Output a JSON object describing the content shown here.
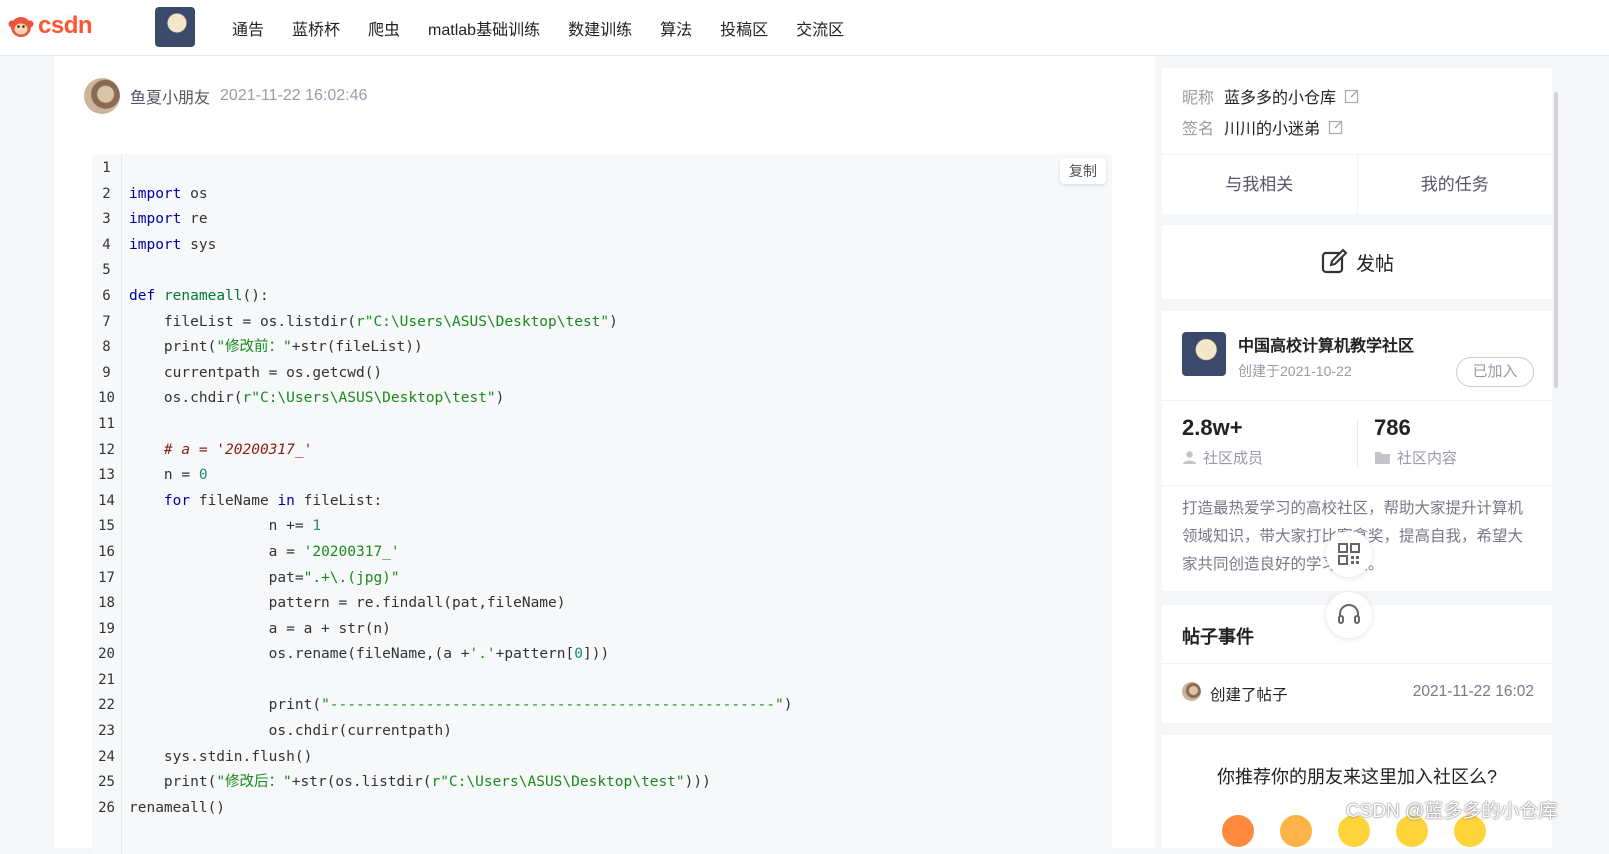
{
  "brand": {
    "logo_text": "csdn"
  },
  "nav": {
    "items": [
      "通告",
      "蓝桥杯",
      "爬虫",
      "matlab基础训练",
      "数建训练",
      "算法",
      "投稿区",
      "交流区"
    ]
  },
  "post": {
    "author": "鱼夏小朋友",
    "time": "2021-11-22 16:02:46",
    "copy_label": "复制"
  },
  "code": {
    "line_numbers": [
      "1",
      "2",
      "3",
      "4",
      "5",
      "6",
      "7",
      "8",
      "9",
      "10",
      "11",
      "12",
      "13",
      "14",
      "15",
      "16",
      "17",
      "18",
      "19",
      "20",
      "21",
      "22",
      "23",
      "24",
      "25",
      "26"
    ],
    "lines": [
      "",
      "import os",
      "import re",
      "import sys",
      "",
      "def renameall():",
      "    fileList = os.listdir(r\"C:\\Users\\ASUS\\Desktop\\test\")",
      "    print(\"修改前：\"+str(fileList))",
      "    currentpath = os.getcwd()",
      "    os.chdir(r\"C:\\Users\\ASUS\\Desktop\\test\")",
      "",
      "    # a = '20200317_'",
      "    n = 0",
      "    for fileName in fileList:",
      "                n += 1",
      "                a = '20200317_'",
      "                pat=\".+\\.(jpg)\"",
      "                pattern = re.findall(pat,fileName)",
      "                a = a + str(n)",
      "                os.rename(fileName,(a +'.'+pattern[0]))",
      "",
      "                print(\"---------------------------------------------------\")",
      "                os.chdir(currentpath)",
      "    sys.stdin.flush()",
      "    print(\"修改后：\"+str(os.listdir(r\"C:\\Users\\ASUS\\Desktop\\test\")))",
      "renameall()"
    ]
  },
  "profile": {
    "nickname_label": "昵称",
    "nickname": "蓝多多的小仓库",
    "signature_label": "签名",
    "signature": "川川的小迷弟",
    "tabs": [
      "与我相关",
      "我的任务"
    ]
  },
  "post_button": {
    "label": "发帖"
  },
  "community": {
    "name": "中国高校计算机教学社区",
    "created": "创建于2021-10-22",
    "joined_label": "已加入",
    "members_count": "2.8w+",
    "members_label": "社区成员",
    "content_count": "786",
    "content_label": "社区内容",
    "description": "打造最热爱学习的高校社区，帮助大家提升计算机领域知识，带大家打比赛拿奖，提高自我，希望大家共同创造良好的学习氛围。"
  },
  "events": {
    "title": "帖子事件",
    "item_text": "创建了帖子",
    "item_time": "2021-11-22 16:02"
  },
  "recommend": {
    "title": "你推荐你的朋友来这里加入社区么?"
  },
  "watermark": "CSDN @蓝多多的小仓库",
  "colors": {
    "brand": "#fc5531",
    "keyword": "#0000a8",
    "string": "#1a8a1a"
  }
}
